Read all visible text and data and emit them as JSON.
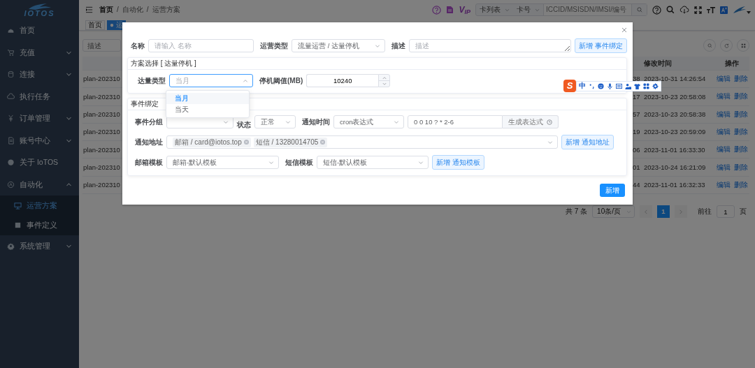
{
  "sidebar": {
    "logo": "IOTOS",
    "items": [
      {
        "label": "首页",
        "kind": "link",
        "selected": false
      },
      {
        "label": "充值",
        "kind": "group",
        "expanded": false,
        "selected": false
      },
      {
        "label": "连接",
        "kind": "group",
        "expanded": false,
        "selected": false
      },
      {
        "label": "执行任务",
        "kind": "link",
        "selected": false
      },
      {
        "label": "订单管理",
        "kind": "group",
        "expanded": false,
        "selected": false
      },
      {
        "label": "账号中心",
        "kind": "group",
        "expanded": false,
        "selected": false
      },
      {
        "label": "关于 IoTOS",
        "kind": "link",
        "selected": false
      },
      {
        "label": "自动化",
        "kind": "group",
        "expanded": true,
        "selected": false,
        "children": [
          {
            "label": "运营方案",
            "selected": true
          },
          {
            "label": "事件定义",
            "selected": false
          }
        ]
      },
      {
        "label": "系统管理",
        "kind": "group",
        "expanded": false,
        "selected": false
      }
    ]
  },
  "header": {
    "breadcrumb": [
      "首页",
      "自动化",
      "运营方案"
    ],
    "separator": "/",
    "vip": "V$_{IP}$",
    "list_select": "卡列表",
    "field_select": "卡号",
    "search": {
      "placeholder": "ICCID/MSISDN/IMSI/编号"
    }
  },
  "tabs": [
    {
      "label": "首页",
      "selected": false
    },
    {
      "label": "● 运",
      "selected": true
    }
  ],
  "filter": {
    "placeholder": "描述"
  },
  "table": {
    "columns": [
      "修改时间",
      "操作"
    ],
    "rows": [
      {
        "column_1": "plan-202310",
        "column_3": "38",
        "modified": "2023-10-31 14:26:54",
        "actions": [
          "编辑",
          "删除"
        ]
      },
      {
        "column_1": "plan-202310",
        "column_3": "17",
        "modified": "2023-10-23 20:58:08",
        "actions": [
          "编辑",
          "删除"
        ]
      },
      {
        "column_1": "plan-202310",
        "column_3": "57",
        "modified": "2023-10-23 20:58:38",
        "actions": [
          "编辑",
          "删除"
        ]
      },
      {
        "column_1": "plan-202310",
        "column_3": "19",
        "modified": "2023-10-23 20:59:09",
        "actions": [
          "编辑",
          "删除"
        ]
      },
      {
        "column_1": "plan-202310",
        "column_3": "06",
        "modified": "2023-11-01 16:33:30",
        "actions": [
          "编辑",
          "删除"
        ]
      },
      {
        "column_1": "plan-202310",
        "column_3": "01",
        "modified": "2023-10-24 16:21:09",
        "actions": [
          "编辑",
          "删除"
        ]
      },
      {
        "column_1": "plan-202310",
        "column_3": "44",
        "modified": "2023-11-01 16:32:33",
        "actions": [
          "编辑",
          "删除"
        ]
      }
    ]
  },
  "pagination": {
    "total": "共 7 条",
    "page_size": "10条/页",
    "pages": [
      {
        "label": "1",
        "selected": true
      }
    ],
    "goto_label": "前往",
    "goto_value": "1",
    "goto_suffix": "页"
  },
  "modal": {
    "name": {
      "label": "名称",
      "placeholder": "请输入 名称"
    },
    "op_type": {
      "label": "运营类型",
      "value": "流量运营 / 达量停机"
    },
    "description": {
      "label": "描述",
      "placeholder": "描述"
    },
    "add_event_button": "新增 事件绑定",
    "plan_card": {
      "title": "方案选择 [ 达量停机 ]",
      "reach_type": {
        "label": "达量类型",
        "placeholder": "当月",
        "open": true,
        "options": [
          {
            "label": "当月",
            "selected": true
          },
          {
            "label": "当天",
            "selected": false
          }
        ]
      },
      "threshold": {
        "label": "停机阈值(MB)",
        "value": "10240"
      }
    },
    "event_card": {
      "title": "事件绑定",
      "group": {
        "label": "事件分组"
      },
      "status": {
        "label": "状态",
        "value": "正常"
      },
      "notify_time": {
        "label": "通知时间",
        "mode": "cron表达式",
        "expression": "0 0 10 ? * 2-6",
        "generate_button": "生成表达式"
      },
      "address": {
        "label": "通知地址",
        "tags": [
          "邮箱 / card@iotos.top",
          "短信 / 13280014705"
        ],
        "add_button": "新增 通知地址"
      },
      "email_template": {
        "label": "邮箱模板",
        "value": "邮箱-默认模板"
      },
      "sms_template": {
        "label": "短信模板",
        "value": "短信-默认模板"
      },
      "add_template_button": "新增 通知模板"
    },
    "submit_button": "新增"
  },
  "ime_toolbar": {
    "logo": "S",
    "mode": "中"
  }
}
